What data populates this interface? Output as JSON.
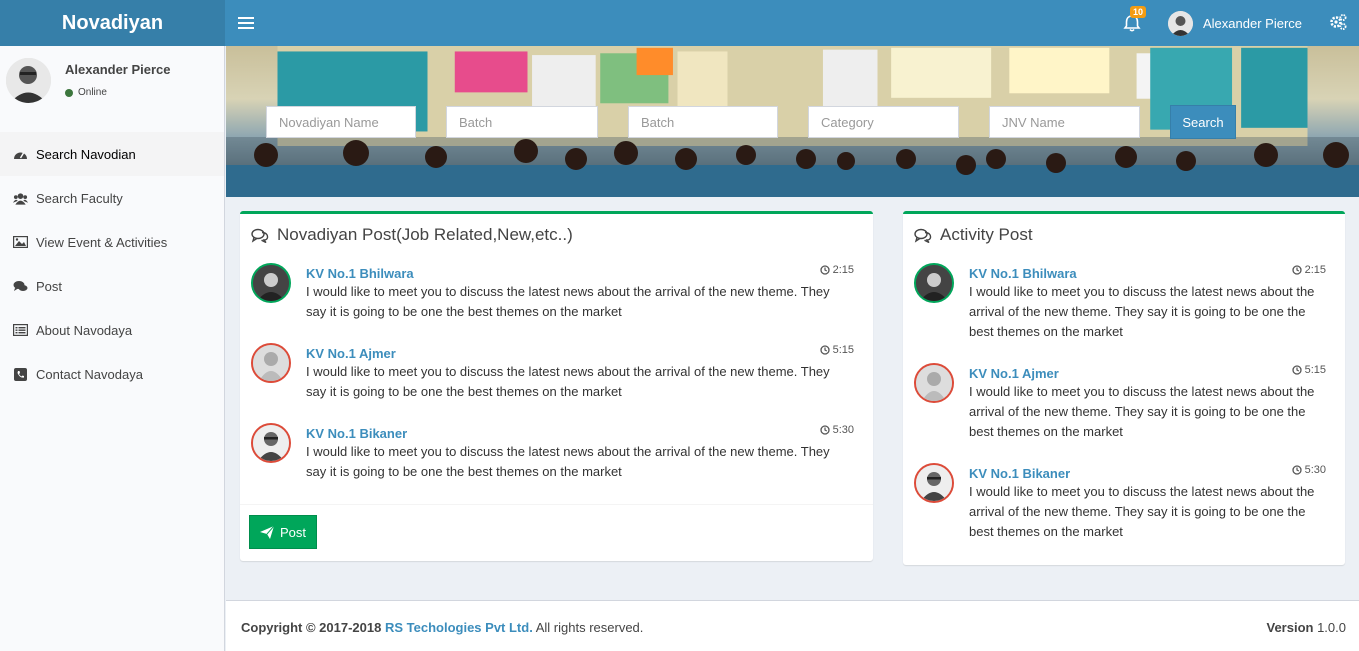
{
  "header": {
    "logo": "Novadiyan",
    "notification_count": "10",
    "user_name": "Alexander Pierce"
  },
  "sidebar": {
    "user_name": "Alexander Pierce",
    "status": "Online",
    "items": [
      {
        "label": "Search Navodian",
        "icon": "dashboard-icon"
      },
      {
        "label": "Search Faculty",
        "icon": "users-icon"
      },
      {
        "label": "View Event & Activities",
        "icon": "image-icon"
      },
      {
        "label": "Post",
        "icon": "comments-icon"
      },
      {
        "label": "About Navodaya",
        "icon": "list-icon"
      },
      {
        "label": "Contact Navodaya",
        "icon": "phone-icon"
      }
    ]
  },
  "search": {
    "name_placeholder": "Novadiyan Name",
    "batch1_placeholder": "Batch",
    "batch2_placeholder": "Batch",
    "category_placeholder": "Category",
    "jnv_placeholder": "JNV Name",
    "button": "Search"
  },
  "posts_box": {
    "title": "Novadiyan Post(Job Related,New,etc..)",
    "items": [
      {
        "who": "KV No.1 Bhilwara",
        "time": "2:15",
        "line1": "I would like to meet you to discuss the latest news about the arrival of the new theme. They",
        "line2": "say it is going to be one the best themes on the market"
      },
      {
        "who": "KV No.1 Ajmer",
        "time": "5:15",
        "line1": "I would like to meet you to discuss the latest news about the arrival of the new theme. They",
        "line2": "say it is going to be one the best themes on the market"
      },
      {
        "who": "KV No.1 Bikaner",
        "time": "5:30",
        "line1": "I would like to meet you to discuss the latest news about the arrival of the new theme. They",
        "line2": "say it is going to be one the best themes on the market"
      }
    ],
    "post_button": "Post"
  },
  "activity_box": {
    "title": "Activity Post",
    "items": [
      {
        "who": "KV No.1 Bhilwara",
        "time": "2:15",
        "line1": "I would like to meet you to discuss the latest news about the",
        "line2": "arrival of the new theme. They say it is going to be one the",
        "line3": "best themes on the market"
      },
      {
        "who": "KV No.1 Ajmer",
        "time": "5:15",
        "line1": "I would like to meet you to discuss the latest news about the",
        "line2": "arrival of the new theme. They say it is going to be one the",
        "line3": "best themes on the market"
      },
      {
        "who": "KV No.1 Bikaner",
        "time": "5:30",
        "line1": "I would like to meet you to discuss the latest news about the",
        "line2": "arrival of the new theme. They say it is going to be one the",
        "line3": "best themes on the market"
      }
    ]
  },
  "footer": {
    "copyright_prefix": "Copyright © 2017-2018",
    "company": "RS Techologies Pvt Ltd.",
    "rights": "All rights reserved.",
    "version_label": "Version",
    "version": "1.0.0"
  },
  "colors": {
    "header": "#3c8dbc",
    "logo_bg": "#367fa9",
    "success": "#00a65a",
    "danger": "#dd4b39",
    "warning": "#f39c12"
  }
}
